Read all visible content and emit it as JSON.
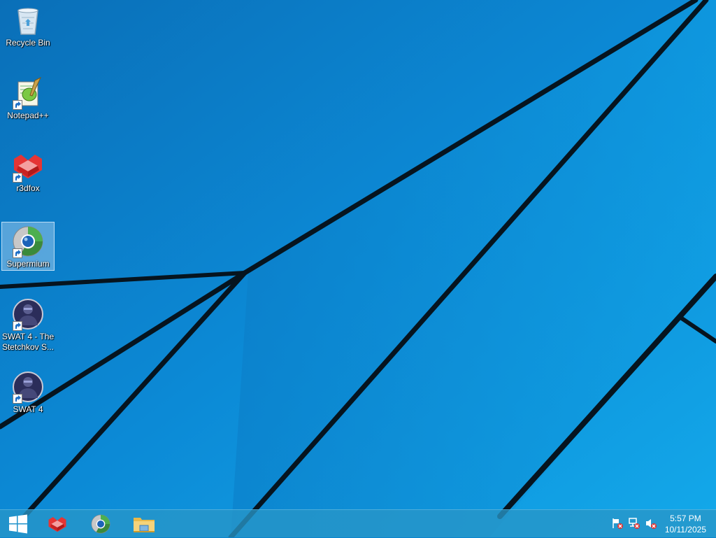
{
  "desktop": {
    "icons": [
      {
        "label": "Recycle Bin",
        "icon": "recycle-bin-icon",
        "shortcut": false
      },
      {
        "label": "Notepad++",
        "icon": "notepad-plus-plus-icon",
        "shortcut": true
      },
      {
        "label": "r3dfox",
        "icon": "r3dfox-icon",
        "shortcut": true
      },
      {
        "label": "Supermium",
        "icon": "supermium-icon",
        "shortcut": true,
        "selected": true
      },
      {
        "label": "SWAT 4 - The Stetchkov S...",
        "icon": "swat4-stetchkov-icon",
        "shortcut": true
      },
      {
        "label": "SWAT 4",
        "icon": "swat4-icon",
        "shortcut": true
      }
    ]
  },
  "taskbar": {
    "start": "windows-start-icon",
    "pinned": [
      "r3dfox-icon",
      "supermium-icon",
      "file-explorer-icon"
    ],
    "tray": [
      "action-center-flag-icon",
      "network-icon",
      "volume-muted-icon"
    ],
    "clock": {
      "time": "5:57 PM",
      "date": "10/11/2025"
    }
  },
  "colors": {
    "wallpaper": "#0b84cf",
    "taskbar": "#2896c8"
  }
}
